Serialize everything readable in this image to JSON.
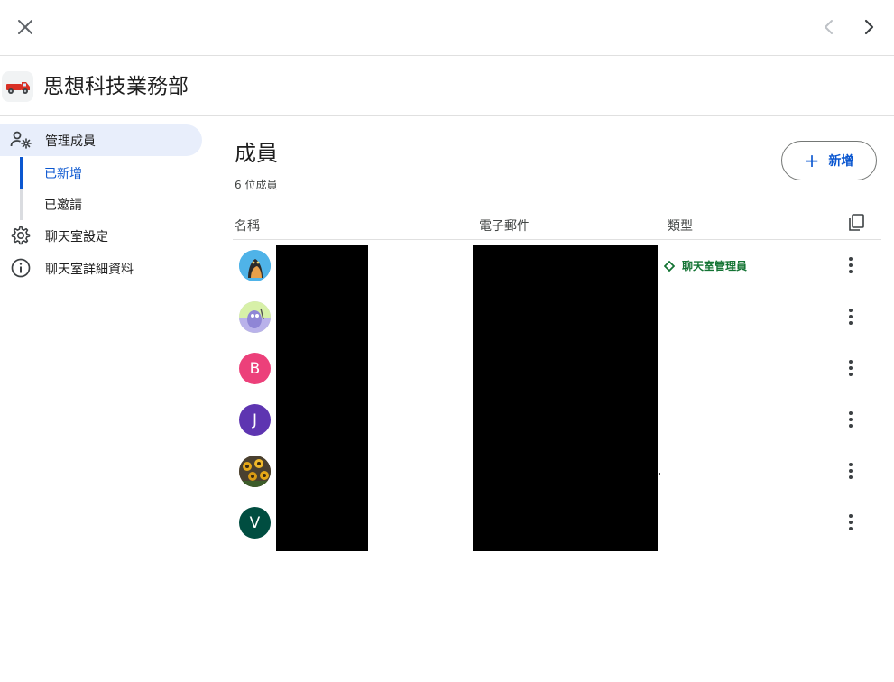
{
  "icons": {
    "close": "close-icon",
    "prev": "chevron-left-icon",
    "next": "chevron-right-icon",
    "room": "truck-icon",
    "manage_members": "person-gear-icon",
    "settings": "gear-icon",
    "details": "info-icon",
    "copy": "copy-icon",
    "more": "more-vert-icon",
    "role": "diamond-icon"
  },
  "room": {
    "title": "思想科技業務部"
  },
  "sidebar": {
    "items": [
      {
        "label": "管理成員",
        "active": true
      },
      {
        "label": "聊天室設定",
        "active": false
      },
      {
        "label": "聊天室詳細資料",
        "active": false
      }
    ],
    "subitems": [
      {
        "label": "已新增",
        "active": true
      },
      {
        "label": "已邀請",
        "active": false
      }
    ]
  },
  "main": {
    "title": "成員",
    "count": "6 位成員",
    "add_button": "新增",
    "columns": [
      "名稱",
      "電子郵件",
      "類型"
    ],
    "members": [
      {
        "avatar": "photo-cat",
        "initial": "",
        "color": "#4fb3e8",
        "role": "聊天室管理員"
      },
      {
        "avatar": "photo-cartoon",
        "initial": "",
        "color": "#c9c2ef",
        "role": ""
      },
      {
        "avatar": "letter",
        "initial": "B",
        "color": "#ec407a",
        "role": ""
      },
      {
        "avatar": "letter",
        "initial": "J",
        "color": "#5e35b1",
        "role": ""
      },
      {
        "avatar": "photo-sunflower",
        "initial": "",
        "color": "#6b5a2a",
        "role": ""
      },
      {
        "avatar": "letter",
        "initial": "V",
        "color": "#004d40",
        "role": ""
      }
    ]
  },
  "colors": {
    "accent": "#0b57d0",
    "active_bg": "#e8eefb",
    "role_green": "#137333",
    "divider": "#e0e0e0"
  }
}
